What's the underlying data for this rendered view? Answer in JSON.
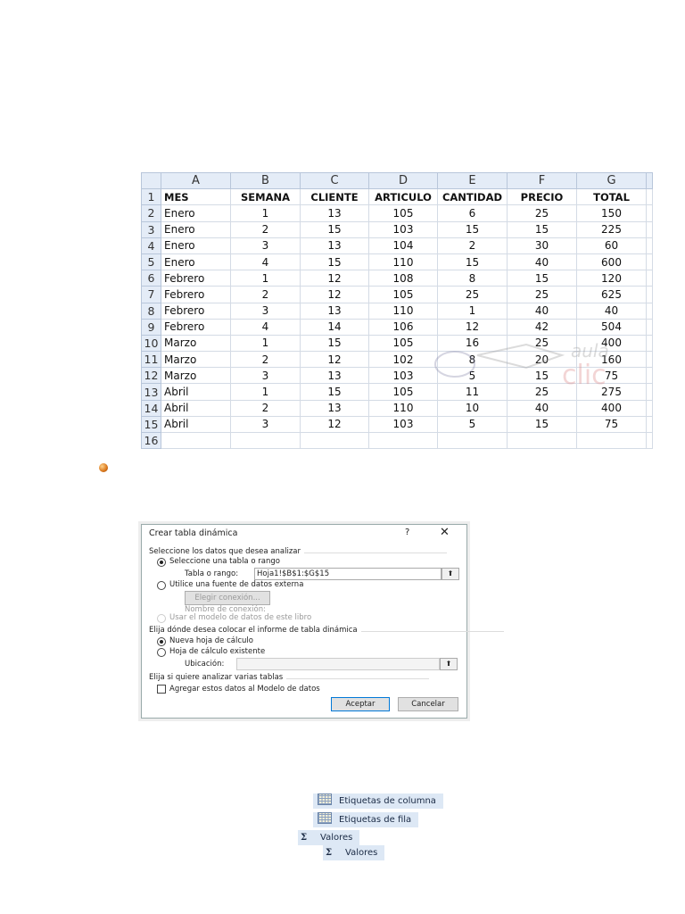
{
  "spreadsheet": {
    "columns": [
      "A",
      "B",
      "C",
      "D",
      "E",
      "F",
      "G"
    ],
    "row_numbers": [
      "1",
      "2",
      "3",
      "4",
      "5",
      "6",
      "7",
      "8",
      "9",
      "10",
      "11",
      "12",
      "13",
      "14",
      "15",
      "16"
    ],
    "headers": [
      "MES",
      "SEMANA",
      "CLIENTE",
      "ARTICULO",
      "CANTIDAD",
      "PRECIO",
      "TOTAL"
    ],
    "rows": [
      [
        "Enero",
        "1",
        "13",
        "105",
        "6",
        "25",
        "150"
      ],
      [
        "Enero",
        "2",
        "15",
        "103",
        "15",
        "15",
        "225"
      ],
      [
        "Enero",
        "3",
        "13",
        "104",
        "2",
        "30",
        "60"
      ],
      [
        "Enero",
        "4",
        "15",
        "110",
        "15",
        "40",
        "600"
      ],
      [
        "Febrero",
        "1",
        "12",
        "108",
        "8",
        "15",
        "120"
      ],
      [
        "Febrero",
        "2",
        "12",
        "105",
        "25",
        "25",
        "625"
      ],
      [
        "Febrero",
        "3",
        "13",
        "110",
        "1",
        "40",
        "40"
      ],
      [
        "Febrero",
        "4",
        "14",
        "106",
        "12",
        "42",
        "504"
      ],
      [
        "Marzo",
        "1",
        "15",
        "105",
        "16",
        "25",
        "400"
      ],
      [
        "Marzo",
        "2",
        "12",
        "102",
        "8",
        "20",
        "160"
      ],
      [
        "Marzo",
        "3",
        "13",
        "103",
        "5",
        "15",
        "75"
      ],
      [
        "Abril",
        "1",
        "15",
        "105",
        "11",
        "25",
        "275"
      ],
      [
        "Abril",
        "2",
        "13",
        "110",
        "10",
        "40",
        "400"
      ],
      [
        "Abril",
        "3",
        "12",
        "103",
        "5",
        "15",
        "75"
      ]
    ],
    "watermark": "aula clic"
  },
  "dialog": {
    "title": "Crear tabla dinámica",
    "help": "?",
    "close": "✕",
    "section1": "Seleccione los datos que desea analizar",
    "opt_table": "Seleccione una tabla o rango",
    "range_label": "Tabla o rango:",
    "range_value": "Hoja1!$B$1:$G$15",
    "opt_external": "Utilice una fuente de datos externa",
    "choose_conn": "Elegir conexión...",
    "conn_name": "Nombre de conexión:",
    "opt_model": "Usar el modelo de datos de este libro",
    "section2": "Elija dónde desea colocar el informe de tabla dinámica",
    "opt_new": "Nueva hoja de cálculo",
    "opt_existing": "Hoja de cálculo existente",
    "location_label": "Ubicación:",
    "location_value": "",
    "section3": "Elija si quiere analizar varias tablas",
    "add_model": "Agregar estos datos al Modelo de datos",
    "ok": "Aceptar",
    "cancel": "Cancelar",
    "up_icon": "⬆"
  },
  "pivot_fields": {
    "col_labels": "Etiquetas de columna",
    "row_labels": "Etiquetas de fila",
    "values1": "Valores",
    "values2": "Valores",
    "sigma": "Σ"
  }
}
